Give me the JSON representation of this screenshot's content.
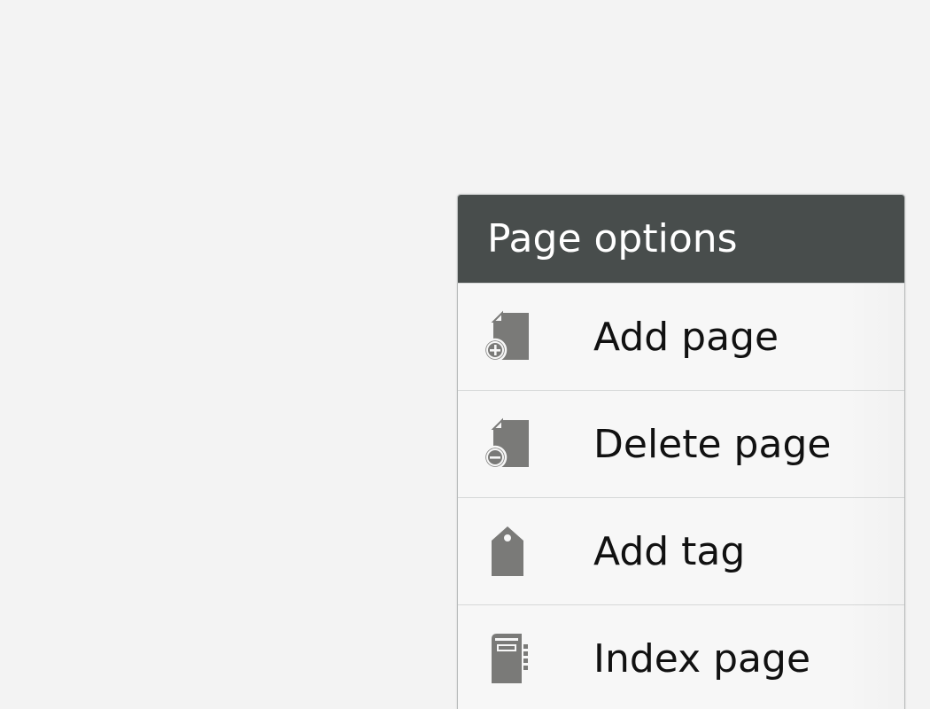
{
  "menu": {
    "title": "Page options",
    "items": [
      {
        "label": "Add page",
        "icon": "add-page-icon"
      },
      {
        "label": "Delete page",
        "icon": "delete-page-icon"
      },
      {
        "label": "Add tag",
        "icon": "tag-icon"
      },
      {
        "label": "Index page",
        "icon": "index-page-icon"
      }
    ]
  },
  "colors": {
    "header_background": "#484d4c",
    "icon": "#7a7a78",
    "page_background": "#f3f3f3"
  }
}
